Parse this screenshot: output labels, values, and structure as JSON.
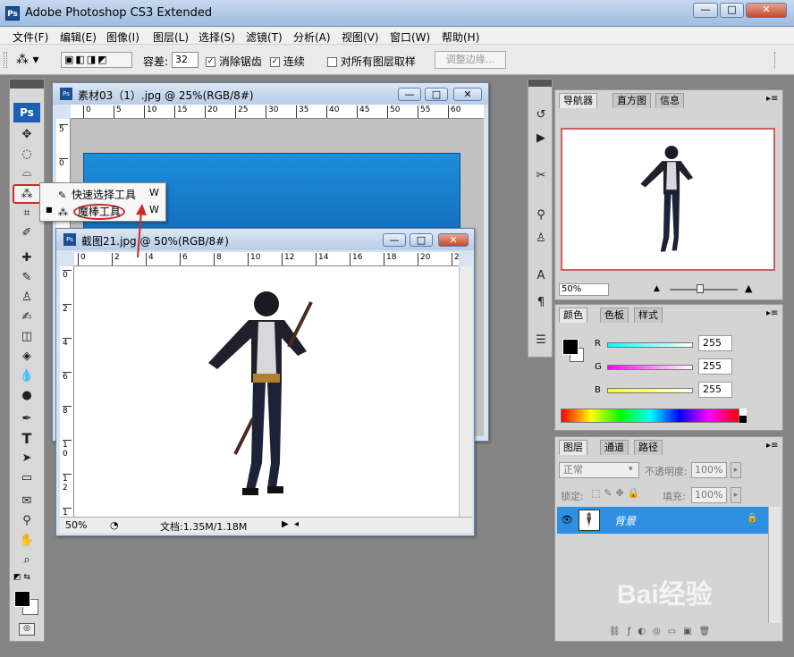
{
  "window": {
    "title": "Adobe Photoshop CS3 Extended",
    "app_icon": "Ps"
  },
  "menu": [
    "文件(F)",
    "编辑(E)",
    "图像(I)",
    "图层(L)",
    "选择(S)",
    "滤镜(T)",
    "分析(A)",
    "视图(V)",
    "窗口(W)",
    "帮助(H)"
  ],
  "options": {
    "tolerance_label": "容差:",
    "tolerance_value": "32",
    "anti_alias_label": "消除锯齿",
    "contiguous_label": "连续",
    "sample_all_label": "对所有图层取样",
    "refine_edge_label": "调整边缘..."
  },
  "toolbox": {
    "logo": "Ps"
  },
  "flyout": {
    "items": [
      {
        "label": "快速选择工具",
        "shortcut": "W"
      },
      {
        "label": "魔棒工具",
        "shortcut": "W"
      }
    ]
  },
  "doc1": {
    "title": "素材03（1）.jpg @ 25%(RGB/8#)",
    "ruler_h": [
      "0",
      "5",
      "10",
      "15",
      "20",
      "25",
      "30",
      "35",
      "40",
      "45",
      "50",
      "55",
      "60"
    ],
    "ruler_v": [
      "5",
      "0"
    ]
  },
  "doc2": {
    "title": "截图21.jpg @ 50%(RGB/8#)",
    "ruler_h": [
      "0",
      "2",
      "4",
      "6",
      "8",
      "10",
      "12",
      "14",
      "16",
      "18",
      "20",
      "2"
    ],
    "ruler_v": [
      "0",
      "2",
      "4",
      "6",
      "8",
      "1 0",
      "1 2",
      "1 4"
    ],
    "zoom": "50%",
    "doc_info": "文档:1.35M/1.18M"
  },
  "navigator": {
    "tabs": [
      "导航器",
      "直方图",
      "信息"
    ],
    "zoom": "50%"
  },
  "color": {
    "tabs": [
      "颜色",
      "色板",
      "样式"
    ],
    "channels": [
      {
        "name": "R",
        "value": "255"
      },
      {
        "name": "G",
        "value": "255"
      },
      {
        "name": "B",
        "value": "255"
      }
    ]
  },
  "layers": {
    "tabs": [
      "图层",
      "通道",
      "路径"
    ],
    "blend_mode": "正常",
    "opacity_label": "不透明度:",
    "opacity_value": "100%",
    "lock_label": "锁定:",
    "fill_label": "填充:",
    "fill_value": "100%",
    "layer_name": "背景"
  },
  "watermark": "Bai经验",
  "colors": {
    "selection": "#2f8fe0",
    "accent_red": "#cc2b2b",
    "panel_bg": "#d4d4d4"
  }
}
